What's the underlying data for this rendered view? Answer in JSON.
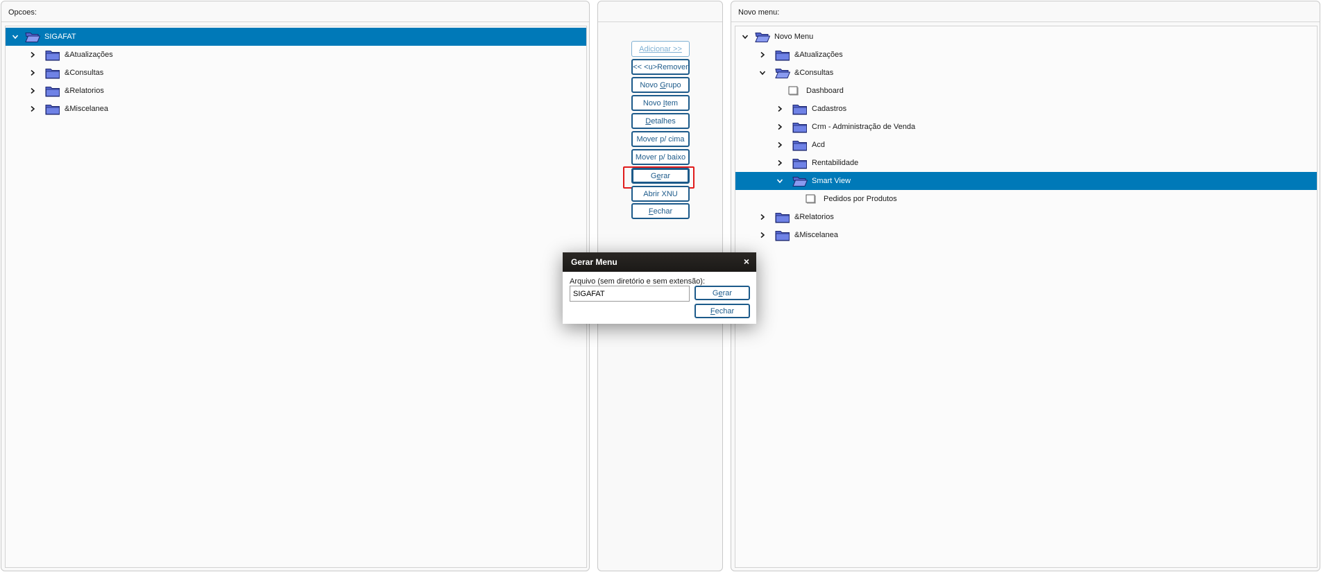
{
  "left_panel": {
    "header": "Opcoes:",
    "root": "SIGAFAT",
    "items": [
      "&Atualizações",
      "&Consultas",
      "&Relatorios",
      "&Miscelanea"
    ]
  },
  "middle_panel": {
    "buttons": {
      "adicionar": "Adicionar >>",
      "remover": "<< <u>Remover",
      "novo_grupo_pre": "Novo ",
      "novo_grupo_u": "G",
      "novo_grupo_post": "rupo",
      "novo_item_pre": "Novo ",
      "novo_item_u": "I",
      "novo_item_post": "tem",
      "detalhes_u": "D",
      "detalhes_post": "etalhes",
      "mover_cima": "Mover p/ cima",
      "mover_baixo": "Mover p/ baixo",
      "gerar_pre": "G",
      "gerar_u": "e",
      "gerar_post": "rar",
      "abrir_xnu": "Abrir XNU",
      "fechar_u": "F",
      "fechar_post": "echar"
    }
  },
  "right_panel": {
    "header": "Novo menu:",
    "root": "Novo Menu",
    "atualizacoes": "&Atualizações",
    "consultas": "&Consultas",
    "dashboard": "Dashboard",
    "cadastros": "Cadastros",
    "crm": "Crm - Administração de Venda",
    "acd": "Acd",
    "rentabilidade": "Rentabilidade",
    "smart_view": "Smart View",
    "pedidos": "Pedidos por Produtos",
    "relatorios": "&Relatorios",
    "miscelanea": "&Miscelanea"
  },
  "dialog": {
    "title": "Gerar Menu",
    "close": "×",
    "label": "Arquivo (sem diretório e sem extensão):",
    "input_value": "SIGAFAT",
    "gerar_pre": "G",
    "gerar_u": "e",
    "gerar_post": "rar",
    "fechar_u": "F",
    "fechar_post": "echar"
  },
  "colors": {
    "selection": "#0079b8",
    "button_border": "#1c5a8a",
    "folder": "#5b6fd6",
    "highlight": "#e01b1b"
  }
}
